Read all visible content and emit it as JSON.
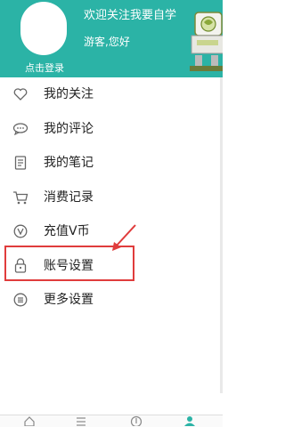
{
  "header": {
    "login_text": "点击登录",
    "welcome_text": "欢迎关注我要自学",
    "guest_text": "游客,您好"
  },
  "menu": {
    "items": [
      {
        "label": "我的关注",
        "icon": "heart-icon"
      },
      {
        "label": "我的评论",
        "icon": "comment-icon"
      },
      {
        "label": "我的笔记",
        "icon": "note-icon"
      },
      {
        "label": "消费记录",
        "icon": "cart-icon"
      },
      {
        "label": "充值V币",
        "icon": "recharge-icon"
      },
      {
        "label": "账号设置",
        "icon": "lock-icon"
      },
      {
        "label": "更多设置",
        "icon": "more-settings-icon"
      }
    ]
  },
  "annotation": {
    "highlight_color": "#e03c3c"
  },
  "theme": {
    "header_color": "#2bb3a6",
    "icon_color": "#666666"
  },
  "bottom_tabs": [
    "home-icon",
    "list-icon",
    "download-icon",
    "profile-icon"
  ]
}
